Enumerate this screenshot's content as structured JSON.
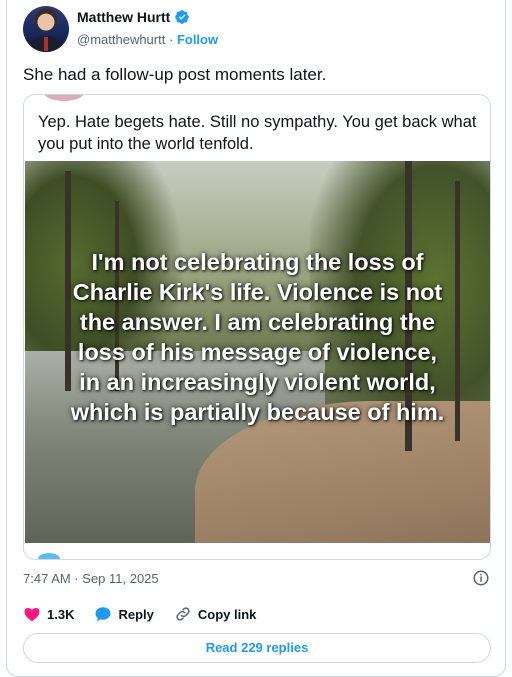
{
  "author": {
    "name": "Matthew Hurtt",
    "handle": "@matthewhurtt",
    "separator": "·",
    "follow_label": "Follow",
    "verified_color": "#1d9bf0"
  },
  "tweet": {
    "text": "She had a follow-up post moments later.",
    "timestamp": "7:47 AM · Sep 11, 2025"
  },
  "quoted_post": {
    "text": "Yep. Hate begets hate. Still no sympathy. You get back what you put into the world tenfold.",
    "image_overlay_lines": [
      "I'm not celebrating the loss of",
      "Charlie Kirk's life. Violence is not",
      "the answer. I am celebrating the",
      "loss of his message of violence,",
      "in an increasingly violent world,",
      "which is partially because of him."
    ]
  },
  "actions": {
    "like_count": "1.3K",
    "reply_label": "Reply",
    "copy_link_label": "Copy link",
    "like_icon": "heart-icon",
    "reply_icon": "speech-bubble-icon",
    "copy_icon": "link-icon",
    "like_color": "#f91880",
    "reply_color": "#1d9bf0"
  },
  "read_replies_label": "Read 229 replies",
  "colors": {
    "accent": "#1d9bf0",
    "muted": "#536471",
    "border": "#cfd9de"
  }
}
